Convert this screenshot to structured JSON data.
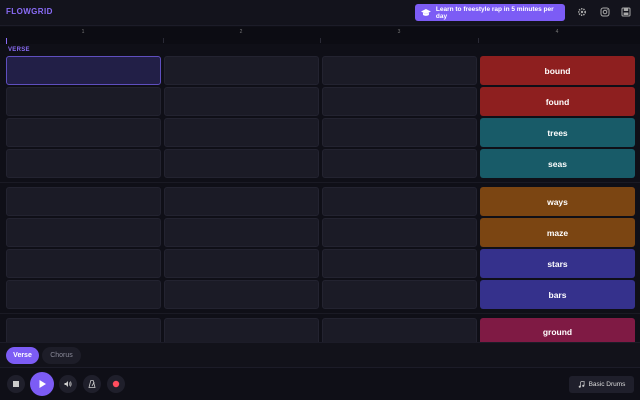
{
  "app": {
    "logo": "FLOWGRID",
    "promo_label": "Learn to freestyle rap in 5 minutes per day",
    "accent_color": "#7c5cf5"
  },
  "header": {
    "icons": [
      "graduation-cap-icon",
      "gear-icon",
      "instagram-icon",
      "save-icon"
    ]
  },
  "ruler": {
    "beats": [
      "1",
      "2",
      "3",
      "4"
    ]
  },
  "section": {
    "label": "VERSE"
  },
  "rows": [
    {
      "word": "bound",
      "color": "#8e1f1f",
      "selected_beat": 1
    },
    {
      "word": "found",
      "color": "#8e1f1f"
    },
    {
      "word": "trees",
      "color": "#185b68"
    },
    {
      "word": "seas",
      "color": "#185b68"
    },
    {
      "word": "ways",
      "color": "#7b4512"
    },
    {
      "word": "maze",
      "color": "#7b4512"
    },
    {
      "word": "stars",
      "color": "#35318c"
    },
    {
      "word": "bars",
      "color": "#35318c"
    },
    {
      "word": "ground",
      "color": "#7f1a44"
    }
  ],
  "tabs": [
    {
      "label": "Verse",
      "active": true
    },
    {
      "label": "Chorus",
      "active": false
    }
  ],
  "transport": {
    "buttons": [
      "stop-icon",
      "play-icon",
      "volume-icon",
      "metronome-icon",
      "record-icon"
    ],
    "drums_label": "Basic Drums",
    "record_color": "#ff4d5e"
  }
}
